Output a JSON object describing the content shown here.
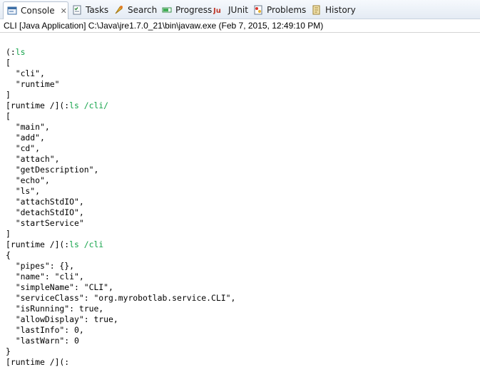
{
  "tabs": [
    {
      "label": "Console",
      "icon": "console-icon",
      "active": true
    },
    {
      "label": "Tasks",
      "icon": "tasks-icon"
    },
    {
      "label": "Search",
      "icon": "search-icon"
    },
    {
      "label": "Progress",
      "icon": "progress-icon"
    },
    {
      "label": "JUnit",
      "icon": "junit-icon"
    },
    {
      "label": "Problems",
      "icon": "problems-icon"
    },
    {
      "label": "History",
      "icon": "history-icon"
    }
  ],
  "close_glyph": "✕",
  "launch_info": "CLI [Java Application] C:\\Java\\jre1.7.0_21\\bin\\javaw.exe (Feb 7, 2015, 12:49:10 PM)",
  "console_lines": [
    {
      "prompt": "",
      "input": ""
    },
    {
      "prompt": "(:",
      "input": "ls"
    },
    {
      "prompt": "[",
      "input": ""
    },
    {
      "prompt": "  \"cli\",",
      "input": ""
    },
    {
      "prompt": "  \"runtime\"",
      "input": ""
    },
    {
      "prompt": "]",
      "input": ""
    },
    {
      "prompt": "[runtime /](:",
      "input": "ls /cli/"
    },
    {
      "prompt": "[",
      "input": ""
    },
    {
      "prompt": "  \"main\",",
      "input": ""
    },
    {
      "prompt": "  \"add\",",
      "input": ""
    },
    {
      "prompt": "  \"cd\",",
      "input": ""
    },
    {
      "prompt": "  \"attach\",",
      "input": ""
    },
    {
      "prompt": "  \"getDescription\",",
      "input": ""
    },
    {
      "prompt": "  \"echo\",",
      "input": ""
    },
    {
      "prompt": "  \"ls\",",
      "input": ""
    },
    {
      "prompt": "  \"attachStdIO\",",
      "input": ""
    },
    {
      "prompt": "  \"detachStdIO\",",
      "input": ""
    },
    {
      "prompt": "  \"startService\"",
      "input": ""
    },
    {
      "prompt": "]",
      "input": ""
    },
    {
      "prompt": "[runtime /](:",
      "input": "ls /cli"
    },
    {
      "prompt": "{",
      "input": ""
    },
    {
      "prompt": "  \"pipes\": {},",
      "input": ""
    },
    {
      "prompt": "  \"name\": \"cli\",",
      "input": ""
    },
    {
      "prompt": "  \"simpleName\": \"CLI\",",
      "input": ""
    },
    {
      "prompt": "  \"serviceClass\": \"org.myrobotlab.service.CLI\",",
      "input": ""
    },
    {
      "prompt": "  \"isRunning\": true,",
      "input": ""
    },
    {
      "prompt": "  \"allowDisplay\": true,",
      "input": ""
    },
    {
      "prompt": "  \"lastInfo\": 0,",
      "input": ""
    },
    {
      "prompt": "  \"lastWarn\": 0",
      "input": ""
    },
    {
      "prompt": "}",
      "input": ""
    },
    {
      "prompt": "[runtime /](:",
      "input": ""
    }
  ]
}
